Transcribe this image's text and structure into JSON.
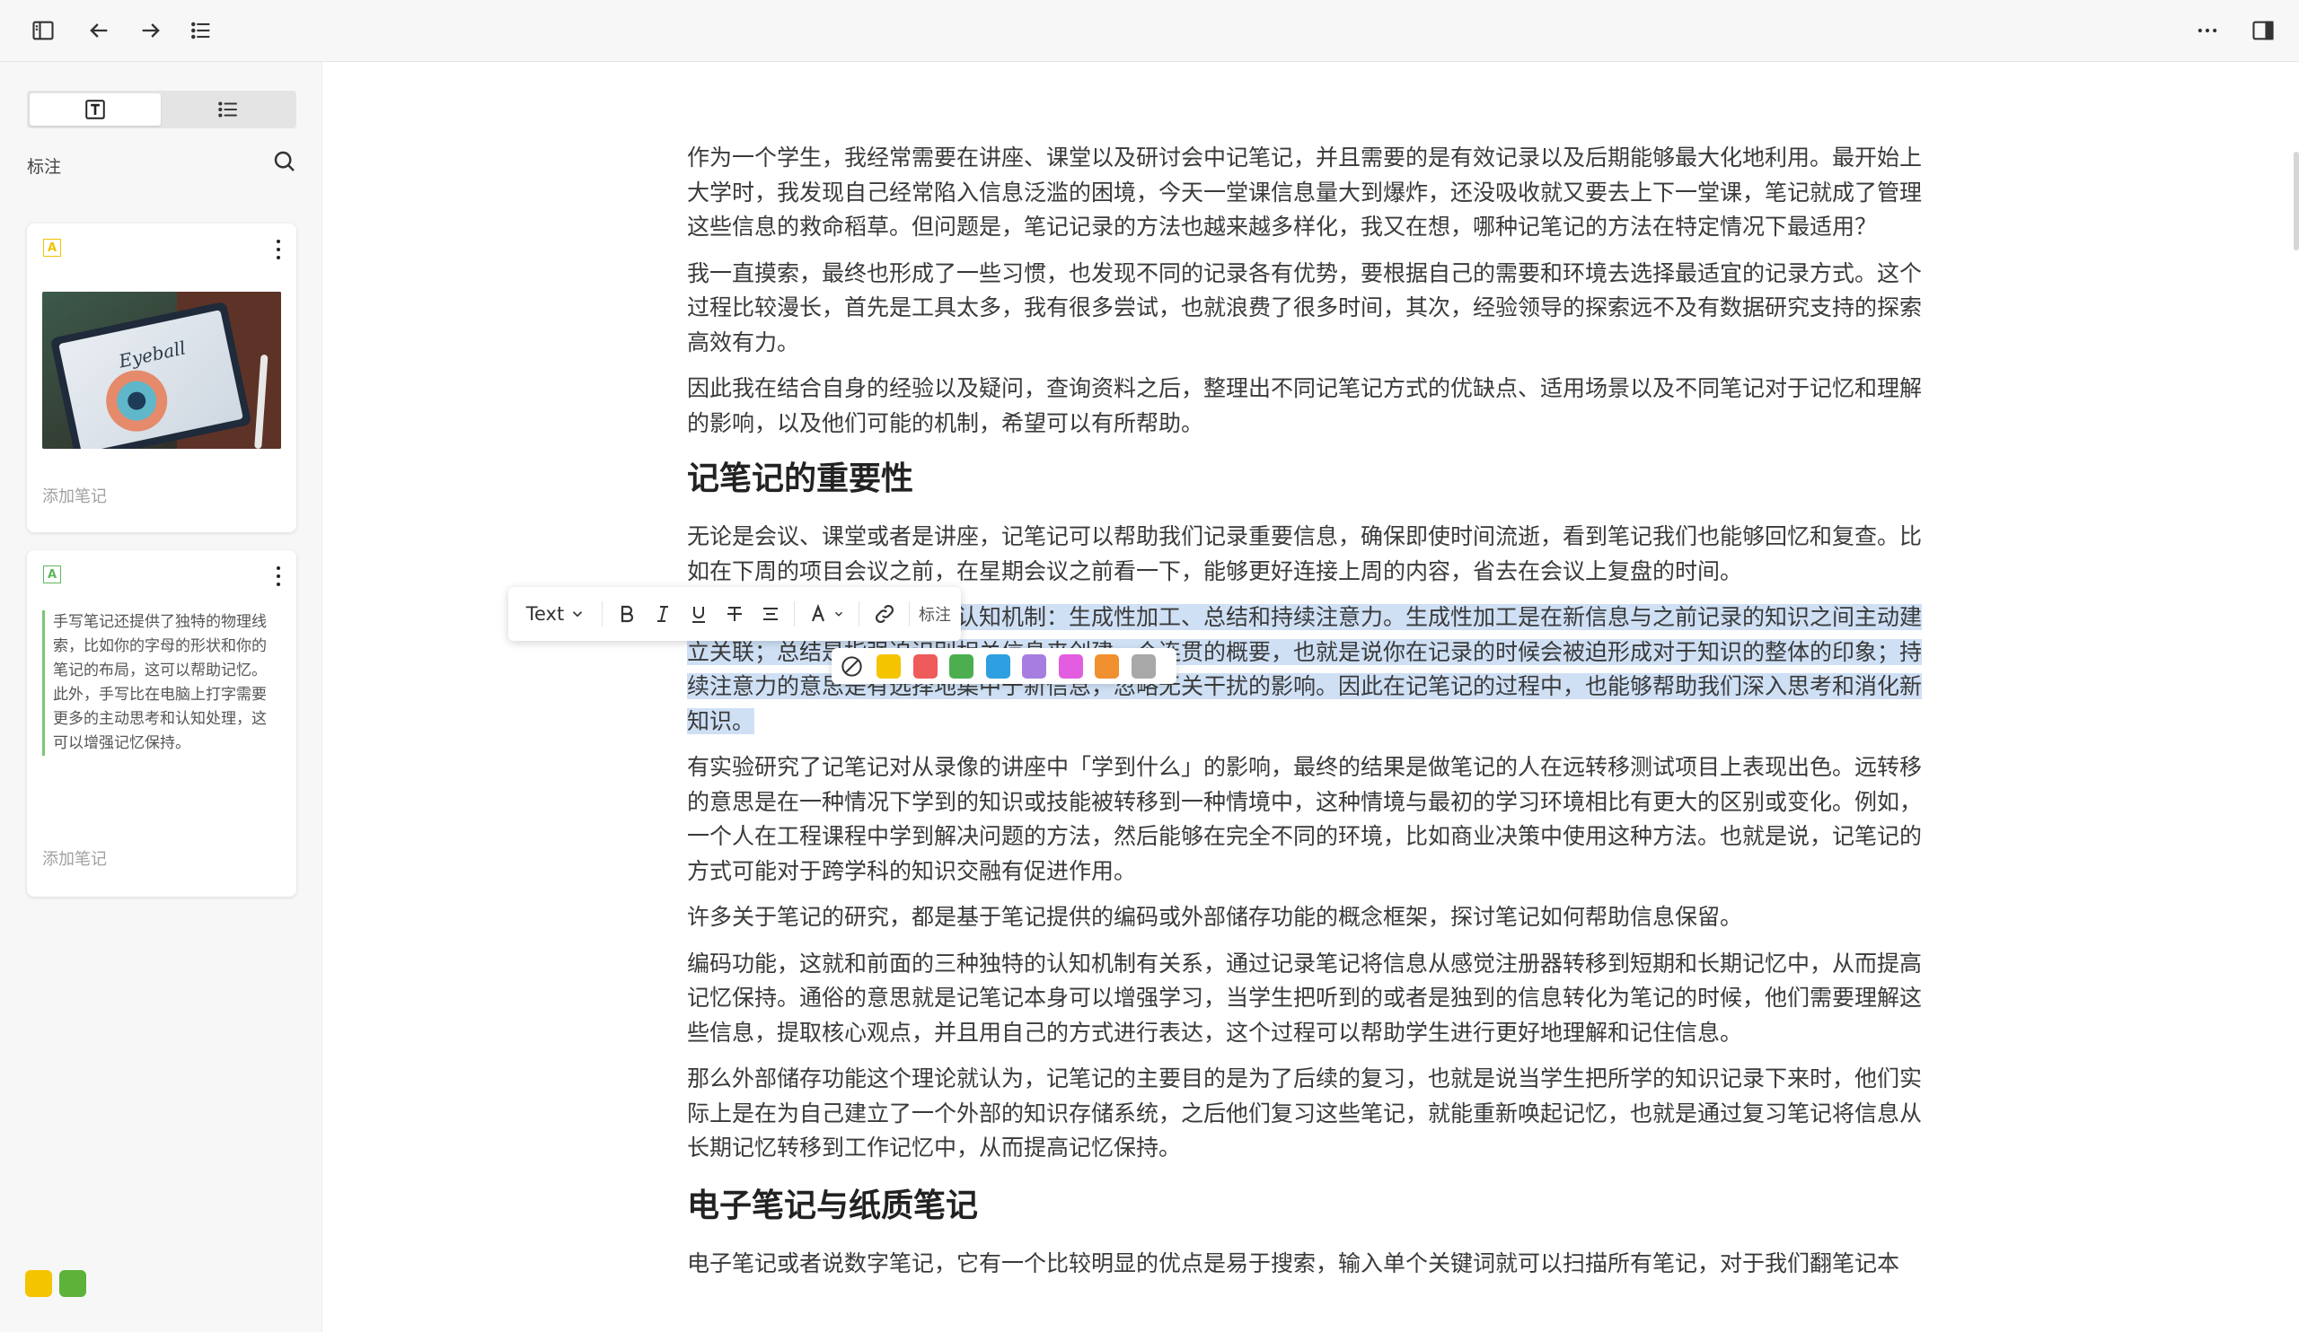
{
  "topbar": {
    "icons": [
      "sidebar-toggle-icon",
      "back-arrow-icon",
      "forward-arrow-icon",
      "outline-list-icon",
      "more-icon",
      "right-panel-icon"
    ]
  },
  "sidebar": {
    "annotations_label": "标注",
    "cards": [
      {
        "type": "image",
        "badge": "A",
        "badge_color": "#f2c200",
        "add_note": "添加笔记",
        "image_caption": "Eyeball"
      },
      {
        "type": "text",
        "badge": "A",
        "badge_color": "#5cb85c",
        "quote": "手写笔记还提供了独特的物理线索，比如你的字母的形状和你的笔记的布局，这可以帮助记忆。此外，手写比在电脑上打字需要更多的主动思考和认知处理，这可以增强记忆保持。",
        "add_note": "添加笔记"
      }
    ],
    "swatches": [
      "#f5c400",
      "#5db33a"
    ]
  },
  "toolbar": {
    "text_style": "Text",
    "annotate_label": "标注"
  },
  "highlight_colors": [
    "#f5c400",
    "#ef5a5a",
    "#4cae4f",
    "#2e9fe0",
    "#a77ee0",
    "#e25de0",
    "#f0902e",
    "#a8a8a8"
  ],
  "document": {
    "p1": "作为一个学生，我经常需要在讲座、课堂以及研讨会中记笔记，并且需要的是有效记录以及后期能够最大化地利用。最开始上大学时，我发现自己经常陷入信息泛滥的困境，今天一堂课信息量大到爆炸，还没吸收就又要去上下一堂课，笔记就成了管理这些信息的救命稻草。但问题是，笔记记录的方法也越来越多样化，我又在想，哪种记笔记的方法在特定情况下最适用？",
    "p2": "我一直摸索，最终也形成了一些习惯，也发现不同的记录各有优势，要根据自己的需要和环境去选择最适宜的记录方式。这个过程比较漫长，首先是工具太多，我有很多尝试，也就浪费了很多时间，其次，经验领导的探索远不及有数据研究支持的探索高效有力。",
    "p3": "因此我在结合自身的经验以及疑问，查询资料之后，整理出不同记笔记方式的优缺点、适用场景以及不同笔记对于记忆和理解的影响，以及他们可能的机制，希望可以有所帮助。",
    "h1": "记笔记的重要性",
    "p4a": "无论是会议、课堂或者是讲座，记笔记可以帮助我们记录重要信息，确保即使时间流逝，看到笔记我们也能够回忆和复查。",
    "p4b": "比如在下周的项目会议之前，在星期会议之前看一下，能够更好连接上周的内容，省去在会议上复盘的时间。",
    "p5": "这个过程中存在三种独特的认知机制：生成性加工、总结和持续注意力。生成性加工是在新信息与之前记录的知识之间主动建立关联；总结是指强迫识别相关信息来创建一个连贯的概要，也就是说你在记录的时候会被迫形成对于知识的整体的印象；持续注意力的意思是有选择地集中于新信息，忽略无关干扰的影响。因此在记笔记的过程中，也能够帮助我们深入思考和消化新知识。",
    "p6": "有实验研究了记笔记对从录像的讲座中「学到什么」的影响，最终的结果是做笔记的人在远转移测试项目上表现出色。远转移的意思是在一种情况下学到的知识或技能被转移到一种情境中，这种情境与最初的学习环境相比有更大的区别或变化。例如，一个人在工程课程中学到解决问题的方法，然后能够在完全不同的环境，比如商业决策中使用这种方法。也就是说，记笔记的方式可能对于跨学科的知识交融有促进作用。",
    "p7": "许多关于笔记的研究，都是基于笔记提供的编码或外部储存功能的概念框架，探讨笔记如何帮助信息保留。",
    "p8": "编码功能，这就和前面的三种独特的认知机制有关系，通过记录笔记将信息从感觉注册器转移到短期和长期记忆中，从而提高记忆保持。通俗的意思就是记笔记本身可以增强学习，当学生把听到的或者是独到的信息转化为笔记的时候，他们需要理解这些信息，提取核心观点，并且用自己的方式进行表达，这个过程可以帮助学生进行更好地理解和记住信息。",
    "p9": "那么外部储存功能这个理论就认为，记笔记的主要目的是为了后续的复习，也就是说当学生把所学的知识记录下来时，他们实际上是在为自己建立了一个外部的知识存储系统，之后他们复习这些笔记，就能重新唤起记忆，也就是通过复习笔记将信息从长期记忆转移到工作记忆中，从而提高记忆保持。",
    "h2": "电子笔记与纸质笔记",
    "p10": "电子笔记或者说数字笔记，它有一个比较明显的优点是易于搜索，输入单个关键词就可以扫描所有笔记，对于我们翻笔记本"
  }
}
